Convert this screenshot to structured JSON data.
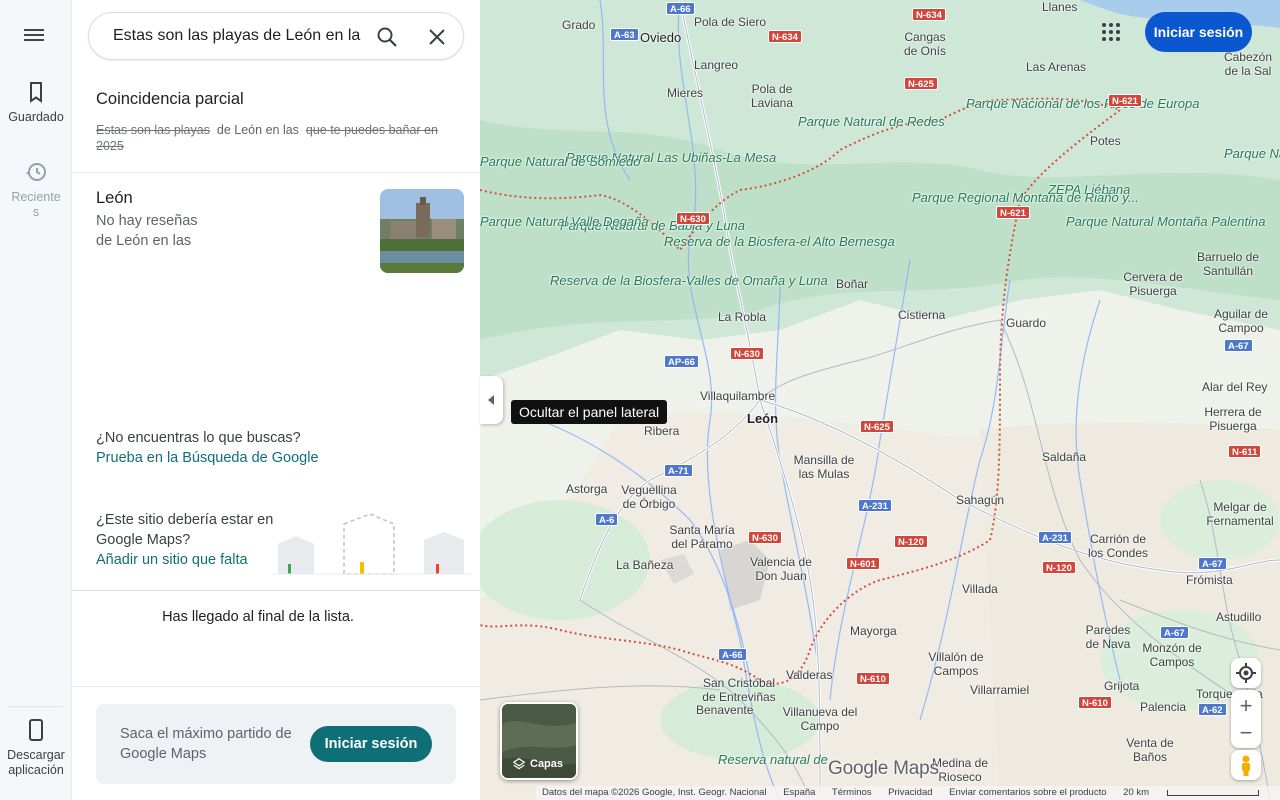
{
  "search": {
    "query": "Estas son las playas de León en las"
  },
  "rail": {
    "saved_label": "Guardado",
    "recent_label": "Recientes",
    "download_label": "Descargar aplicación"
  },
  "partial": {
    "title": "Coincidencia parcial",
    "struck_1": "Estas son las playas",
    "kept": "de León en las",
    "struck_2": "que te puedes bañar en 2025"
  },
  "result": {
    "name": "León",
    "reviews": "No hay reseñas",
    "location": "de León en las"
  },
  "notfound": {
    "question": "¿No encuentras lo que buscas?",
    "link": "Prueba en la Búsqueda de Google"
  },
  "missing": {
    "question": "¿Este sitio debería estar en Google Maps?",
    "link": "Añadir un sitio que falta"
  },
  "end_of_list": "Has llegado al final de la lista.",
  "promo": {
    "text": "Saca el máximo partido de Google Maps",
    "button": "Iniciar sesión"
  },
  "tooltip": "Ocultar el panel lateral",
  "map": {
    "signin": "Iniciar sesión",
    "layers_label": "Capas",
    "logo": "Google Maps",
    "attribution": [
      "Datos del mapa ©2026 Google, Inst. Geogr. Nacional",
      "España",
      "Términos",
      "Privacidad",
      "Enviar comentarios sobre el producto",
      "20 km"
    ],
    "cities": [
      "Grado",
      "Oviedo",
      "Pola de Siero",
      "Llanes",
      "Cangas de Onís",
      "Langreo",
      "Pola de Laviana",
      "Las Arenas",
      "Cabezón de la Sal",
      "Mieres",
      "Potes",
      "La Robla",
      "Boñar",
      "Cistierna",
      "Guardo",
      "Cervera de Pisuerga",
      "Barruelo de Santullán",
      "Aguilar de Campoo",
      "Villaquilambre",
      "León",
      "Alar del Rey",
      "Herrera de Pisuerga",
      "Mansilla de las Mulas",
      "Saldaña",
      "Astorga",
      "Veguellina de Órbigo",
      "Santa María del Páramo",
      "Sahagún",
      "Carrión de los Condes",
      "Melgar de Fernamental",
      "La Bañeza",
      "Valencia de Don Juan",
      "Frómista",
      "Villada",
      "Astudillo",
      "Mayorga",
      "Paredes de Nava",
      "Monzón de Campos",
      "Villalón de Campos",
      "Villarramiel",
      "Grijota",
      "Torquemada",
      "San Cristóbal de Entreviñas",
      "Valderas",
      "Palencia",
      "Benavente",
      "Villanueva del Campo",
      "Venta de Baños",
      "Medina de Rioseco",
      "Ribera"
    ],
    "parks": [
      "Parque Nacional de los Picos de Europa",
      "Parque Natural de Redes",
      "Parque Natural Las Ubiñas-La Mesa",
      "Parque Natural de Somiedo",
      "ZEPA Liébana",
      "Parque Natural Montaña Palentina",
      "Parque Regional Montaña de Riaño y...",
      "Parque Natural de Babia y Luna",
      "Reserva de la Biosfera-el Alto Bernesga",
      "Reserva de la Biosfera-Valles de Omaña y Luna",
      "Parque Natural Saja-Be",
      "Reserva natural de",
      "Parque Natural Valle Degaña"
    ],
    "roads": [
      "A-66",
      "A-63",
      "N-634",
      "N-625",
      "N-621",
      "N-630",
      "AP-66",
      "A-71",
      "A-6",
      "A-231",
      "N-601",
      "N-120",
      "A-67",
      "N-611",
      "N-610",
      "A-62"
    ]
  }
}
